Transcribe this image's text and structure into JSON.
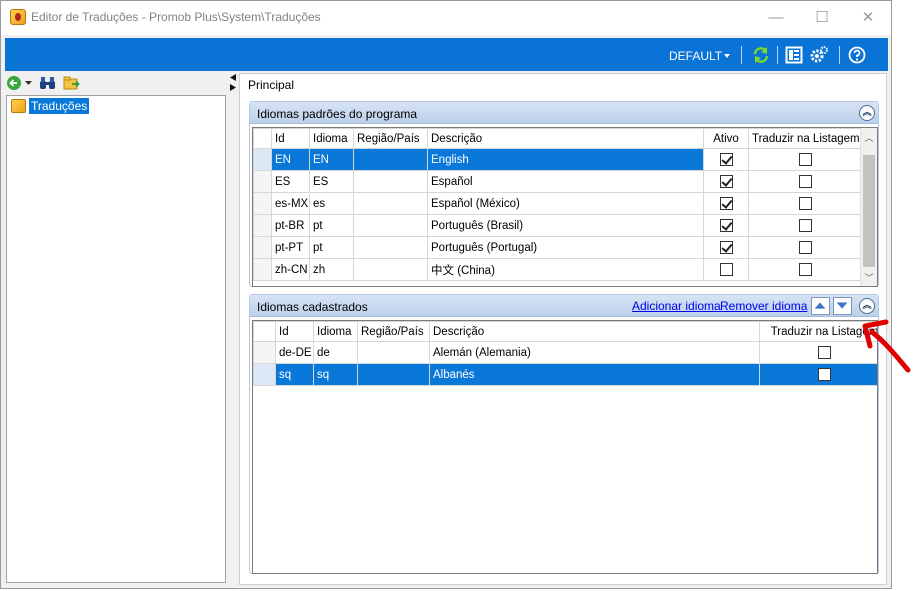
{
  "window": {
    "title": "Editor de Traduções - Promob Plus\\System\\Traduções",
    "minimize": "—",
    "maximize": "☐",
    "close": "✕"
  },
  "toolbar": {
    "profile_label": "DEFAULT"
  },
  "tree": {
    "root_label": "Traduções"
  },
  "main": {
    "tab_label": "Principal"
  },
  "default_languages": {
    "title": "Idiomas padrões do programa",
    "columns": [
      "Id",
      "Idioma",
      "Região/País",
      "Descrição",
      "Ativo",
      "Traduzir na Listagem"
    ],
    "rows": [
      {
        "id": "EN",
        "idioma": "EN",
        "regiao": "",
        "descricao": "English",
        "ativo": true,
        "traduzir": false,
        "selected": true
      },
      {
        "id": "ES",
        "idioma": "ES",
        "regiao": "",
        "descricao": "Español",
        "ativo": true,
        "traduzir": false,
        "selected": false
      },
      {
        "id": "es-MX",
        "idioma": "es",
        "regiao": "",
        "descricao": "Español (México)",
        "ativo": true,
        "traduzir": false,
        "selected": false
      },
      {
        "id": "pt-BR",
        "idioma": "pt",
        "regiao": "",
        "descricao": "Português (Brasil)",
        "ativo": true,
        "traduzir": false,
        "selected": false
      },
      {
        "id": "pt-PT",
        "idioma": "pt",
        "regiao": "",
        "descricao": "Português (Portugal)",
        "ativo": true,
        "traduzir": false,
        "selected": false
      },
      {
        "id": "zh-CN",
        "idioma": "zh",
        "regiao": "",
        "descricao": "中文 (China)",
        "ativo": false,
        "traduzir": false,
        "selected": false
      }
    ]
  },
  "registered_languages": {
    "title": "Idiomas cadastrados",
    "add_link": "Adicionar idioma",
    "remove_link": "Remover idioma",
    "columns": [
      "Id",
      "Idioma",
      "Região/País",
      "Descrição",
      "Traduzir na Listagem"
    ],
    "rows": [
      {
        "id": "de-DE",
        "idioma": "de",
        "regiao": "",
        "descricao": "Alemán (Alemania)",
        "traduzir": false,
        "selected": false
      },
      {
        "id": "sq",
        "idioma": "sq",
        "regiao": "",
        "descricao": "Albanés",
        "traduzir": false,
        "selected": true
      }
    ]
  },
  "colors": {
    "accent": "#0a73d6",
    "selection": "#0a78d8",
    "annotation_arrow": "#e00000"
  }
}
